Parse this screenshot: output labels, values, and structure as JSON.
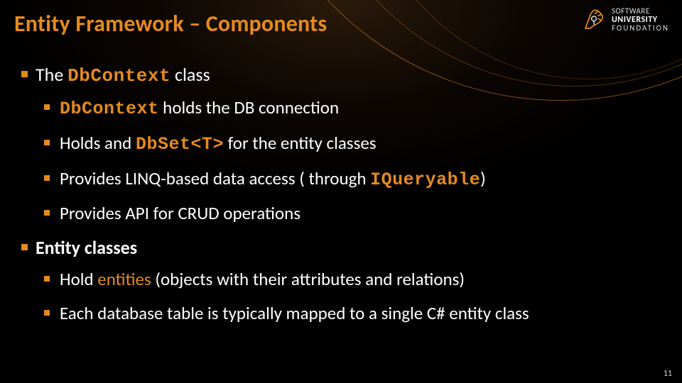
{
  "title": "Entity Framework – Components",
  "logo": {
    "line1": "SOFTWARE",
    "line2": "UNIVERSITY",
    "line3": "FOUNDATION"
  },
  "items": [
    {
      "prefix": "The ",
      "code": "DbContext",
      "suffix": " class",
      "children": [
        {
          "code": "DbContext",
          "text": " holds the DB connection"
        },
        {
          "pre": "Holds and ",
          "code": "DbSet<T>",
          "post": " for the entity classes"
        },
        {
          "pre": "Provides LINQ-based data access ( through ",
          "code": "IQueryable",
          "post": ")"
        },
        {
          "text": "Provides API for CRUD operations"
        }
      ]
    },
    {
      "bold": "Entity classes",
      "children": [
        {
          "pre": "Hold ",
          "accent": "entities",
          "post": " (objects with their attributes and relations)"
        },
        {
          "text": "Each database table is typically mapped to a single C# entity class"
        }
      ]
    }
  ],
  "page_number": "11"
}
